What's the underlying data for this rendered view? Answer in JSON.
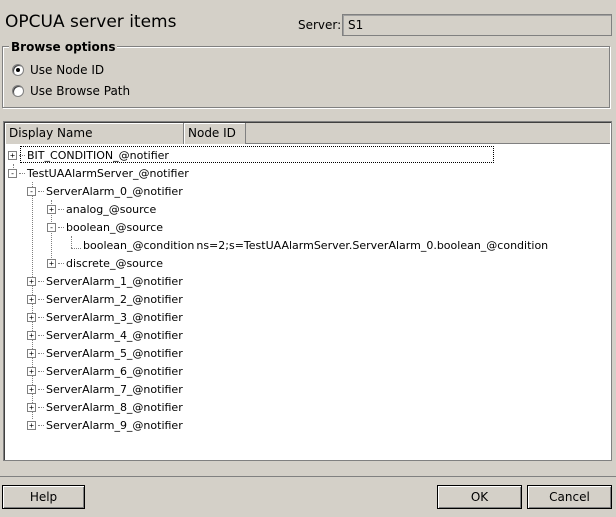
{
  "header": {
    "title": "OPCUA server items",
    "server_label": "Server:",
    "server_value": "S1"
  },
  "browse_options": {
    "legend": "Browse options",
    "use_node_id": "Use Node ID",
    "use_browse_path": "Use Browse Path",
    "selected": "use_node_id"
  },
  "tree": {
    "columns": [
      "Display Name",
      "Node ID"
    ],
    "items": [
      {
        "label": "BIT_CONDITION_@notifier",
        "node_id": "",
        "expander": "+"
      },
      {
        "label": "TestUAAlarmServer_@notifier",
        "node_id": "",
        "expander": "-"
      },
      {
        "label": "ServerAlarm_0_@notifier",
        "node_id": "",
        "expander": "-"
      },
      {
        "label": "analog_@source",
        "node_id": "",
        "expander": "+"
      },
      {
        "label": "boolean_@source",
        "node_id": "",
        "expander": "-"
      },
      {
        "label": "boolean_@condition",
        "node_id": "ns=2;s=TestUAAlarmServer.ServerAlarm_0.boolean_@condition",
        "expander": ""
      },
      {
        "label": "discrete_@source",
        "node_id": "",
        "expander": "+"
      },
      {
        "label": "ServerAlarm_1_@notifier",
        "node_id": "",
        "expander": "+"
      },
      {
        "label": "ServerAlarm_2_@notifier",
        "node_id": "",
        "expander": "+"
      },
      {
        "label": "ServerAlarm_3_@notifier",
        "node_id": "",
        "expander": "+"
      },
      {
        "label": "ServerAlarm_4_@notifier",
        "node_id": "",
        "expander": "+"
      },
      {
        "label": "ServerAlarm_5_@notifier",
        "node_id": "",
        "expander": "+"
      },
      {
        "label": "ServerAlarm_6_@notifier",
        "node_id": "",
        "expander": "+"
      },
      {
        "label": "ServerAlarm_7_@notifier",
        "node_id": "",
        "expander": "+"
      },
      {
        "label": "ServerAlarm_8_@notifier",
        "node_id": "",
        "expander": "+"
      },
      {
        "label": "ServerAlarm_9_@notifier",
        "node_id": "",
        "expander": "+"
      }
    ]
  },
  "buttons": {
    "help": "Help",
    "ok": "OK",
    "cancel": "Cancel"
  }
}
